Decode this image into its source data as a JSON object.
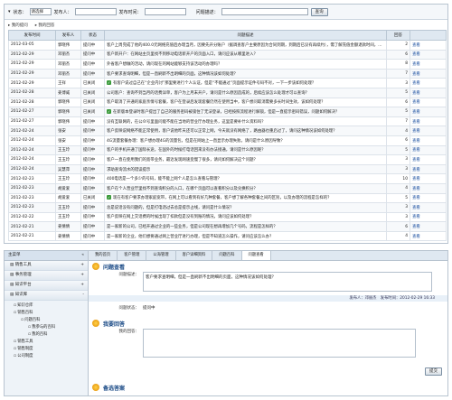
{
  "filter": {
    "status_label": "状态：",
    "status_value": "请选择",
    "sender_label": "发布人：",
    "time_label": "发布时间：",
    "desc_label": "问题描述：",
    "search_button": "查询"
  },
  "tabs": [
    "我的提问",
    "我的回答"
  ],
  "table": {
    "headers": [
      "发布时间",
      "发布人",
      "状态",
      "问题描述",
      "回答",
      ""
    ],
    "rows": [
      {
        "date": "2012-03-05",
        "user": "郭晓伟",
        "status": "提问中",
        "check": false,
        "desc": "客户上周完成了他的400.0元网络充值后办理当月，因要先开分账户（据调查客户主要原因为合同到期，到期后已没有再续约），需了解充值金额退款时间，请帮忙查询一下。",
        "answers": "2",
        "action": "查看"
      },
      {
        "date": "2012-02-29",
        "user": "邓丽杰",
        "status": "提问中",
        "check": false,
        "desc": "客户新开户：在网站主页里找不到移动电话新开户的页面入口，请问应该从哪里进入？",
        "answers": "6",
        "action": "查看"
      },
      {
        "date": "2012-02-29",
        "user": "邓丽杰",
        "status": "提问中",
        "check": false,
        "desc": "外省客户想做的活动，请问现在的网站能够支持该活动的办理吗？",
        "answers": "8",
        "action": "查看"
      },
      {
        "date": "2012-02-29",
        "user": "邓丽杰",
        "status": "提问中",
        "check": false,
        "desc": "客户要求查询明细，但是一直刷新不出明细的页面，这种情况该如何处理？",
        "answers": "7",
        "action": "查看"
      },
      {
        "date": "2012-02-29",
        "user": "王祥",
        "status": "已关闭",
        "check": true,
        "desc": "有客户说过自己在“企业内讨”那里要进行个人认证，但是“不能通过”页面提示证件号码不对，一下一步该如何处理？",
        "answers": "3",
        "action": "查看"
      },
      {
        "date": "2012-02-28",
        "user": "姜博威",
        "status": "已关闭",
        "check": false,
        "desc": "公司客户：查询不到当月的话费详单，客户为上月末开户，请问是什么原因造成的，后续应该怎么处理才可以查询？",
        "answers": "5",
        "action": "查看"
      },
      {
        "date": "2012-02-28",
        "user": "郭晓伟",
        "status": "已关闭",
        "check": false,
        "desc": "客户取消了开通的家庭亲情号套餐，客户在登录后发现套餐仍然在使用当中，客户想问取消需要多长时间生效，该如何处理？",
        "answers": "6",
        "action": "查看"
      },
      {
        "date": "2012-02-27",
        "user": "郭晓伟",
        "status": "已关闭",
        "check": true,
        "desc": "在新版本登录时客户提出了自己的服务密码被锁住了无法登录，已经按照流程进行解锁，但是一直提示密码错误，问题如何解决？",
        "answers": "5",
        "action": "查看"
      },
      {
        "date": "2012-02-27",
        "user": "郭晓伟",
        "status": "提问中",
        "check": false,
        "desc": "没有互联网的，在公众号里面问能不能在当地的营业厅办理业务，这里是要补什么资料吗？",
        "answers": "7",
        "action": "查看"
      },
      {
        "date": "2012-02-24",
        "user": "张安",
        "status": "提问中",
        "check": false,
        "desc": "客户反映说网络不能正常使用，客户说他昨天还可以正常上网，今天就没有网络了，路由器也重启过了，请问这种情况该如何处理？",
        "answers": "4",
        "action": "查看"
      },
      {
        "date": "2012-02-24",
        "user": "张安",
        "status": "提问中",
        "check": false,
        "desc": "4G流量套餐办理：客户想办理4G的流量包，但是在网站上一直显示办理失败，请问是什么原因导致？",
        "answers": "6",
        "action": "查看"
      },
      {
        "date": "2012-02-24",
        "user": "王玉玲",
        "status": "提问中",
        "check": false,
        "desc": "客户的手机开通了国际长途，在国外的时候打电话回来没有办法接通，请问是什么原因呢？",
        "answers": "5",
        "action": "查看"
      },
      {
        "date": "2012-02-24",
        "user": "王玉玲",
        "status": "提问中",
        "check": false,
        "desc": "客户一直在使用我们的宽带业务，最近发现网速变慢了很多，请问如何解决这个问题？",
        "answers": "3",
        "action": "查看"
      },
      {
        "date": "2012-02-24",
        "user": "吴慧萍",
        "status": "提问中",
        "check": false,
        "desc": "求助查询流水的错误提示",
        "answers": "3",
        "action": "查看"
      },
      {
        "date": "2012-02-23",
        "user": "王玉玲",
        "status": "提问中",
        "check": false,
        "desc": "400电话是一个多少的号码，能不能上网个人是怎么查看与管理？",
        "answers": "10",
        "action": "查看"
      },
      {
        "date": "2012-02-23",
        "user": "胡爱爱",
        "status": "提问中",
        "check": false,
        "desc": "客户在个人营业厅里找不到查询积分的入口，在哪个页面可以查看积分以及兑换积分？",
        "answers": "4",
        "action": "查看"
      },
      {
        "date": "2012-02-23",
        "user": "胡爱爱",
        "status": "已关闭",
        "check": true,
        "desc": "现在有客户要求办理家庭宽带，在网上可以看到有好几种套餐，客户想了解各种套餐之间的区别，以及办理的流程是怎样的？",
        "answers": "5",
        "action": "查看"
      },
      {
        "date": "2012-02-23",
        "user": "王玉玲",
        "status": "提问中",
        "check": false,
        "desc": "总是说话没有问题的，但是打电话过去总是提示占线，请问是什么情况？",
        "answers": "3",
        "action": "查看"
      },
      {
        "date": "2012-02-22",
        "user": "王玉玲",
        "status": "提问中",
        "check": false,
        "desc": "客户反映在网上交话费的时候出现了扣款但是没有到账的情况，请问应该如何处理？",
        "answers": "3",
        "action": "查看"
      },
      {
        "date": "2012-02-21",
        "user": "姜倩倩",
        "status": "提问中",
        "check": false,
        "desc": "是一家新的公司，已经开通过企业的一些业务，但是公司现在想再增加几个号码，流程是怎样的？",
        "answers": "6",
        "action": "查看"
      },
      {
        "date": "2012-02-21",
        "user": "姜倩倩",
        "status": "提问中",
        "check": false,
        "desc": "是一家新的企业，他们想要通过网上营业厅进行办理，但是不知道怎么操作，请问应该怎么办？",
        "answers": "4",
        "action": "查看"
      }
    ]
  },
  "sidebar": {
    "header": "主菜单",
    "groups": [
      {
        "label": "销售工具",
        "ctl": "+"
      },
      {
        "label": "事务管理",
        "ctl": "+"
      },
      {
        "label": "知识平台",
        "ctl": "+"
      },
      {
        "label": "知识库",
        "ctl": "-"
      }
    ],
    "tree": [
      {
        "label": "知识仓库",
        "level": 1
      },
      {
        "label": "销售百科",
        "level": 1
      },
      {
        "label": "问题百科",
        "level": 2
      },
      {
        "label": "我参与的百科",
        "level": 3
      },
      {
        "label": "我的百科",
        "level": 3
      },
      {
        "label": "销售工具",
        "level": 1
      },
      {
        "label": "销售制度",
        "level": 1
      },
      {
        "label": "公司制度",
        "level": 1
      }
    ]
  },
  "main_tabs": [
    "我的首页",
    "客户管理",
    "公海管理",
    "客户详细资料",
    "问题百科",
    "问题查看"
  ],
  "question": {
    "title": "问题查看",
    "desc_label": "问题描述：",
    "desc_value": "客户要求查明细，但是一直刷新不出明细的页面，这种情况该如何处理？",
    "meta": "发布人：邓丽杰　发布时间：2012-02-29 16:33",
    "status_label": "问题状态：",
    "status_value": "提问中"
  },
  "answer": {
    "title": "我要回答",
    "label": "我的回答：",
    "submit": "提交"
  },
  "candidates": {
    "title": "备选答案"
  }
}
